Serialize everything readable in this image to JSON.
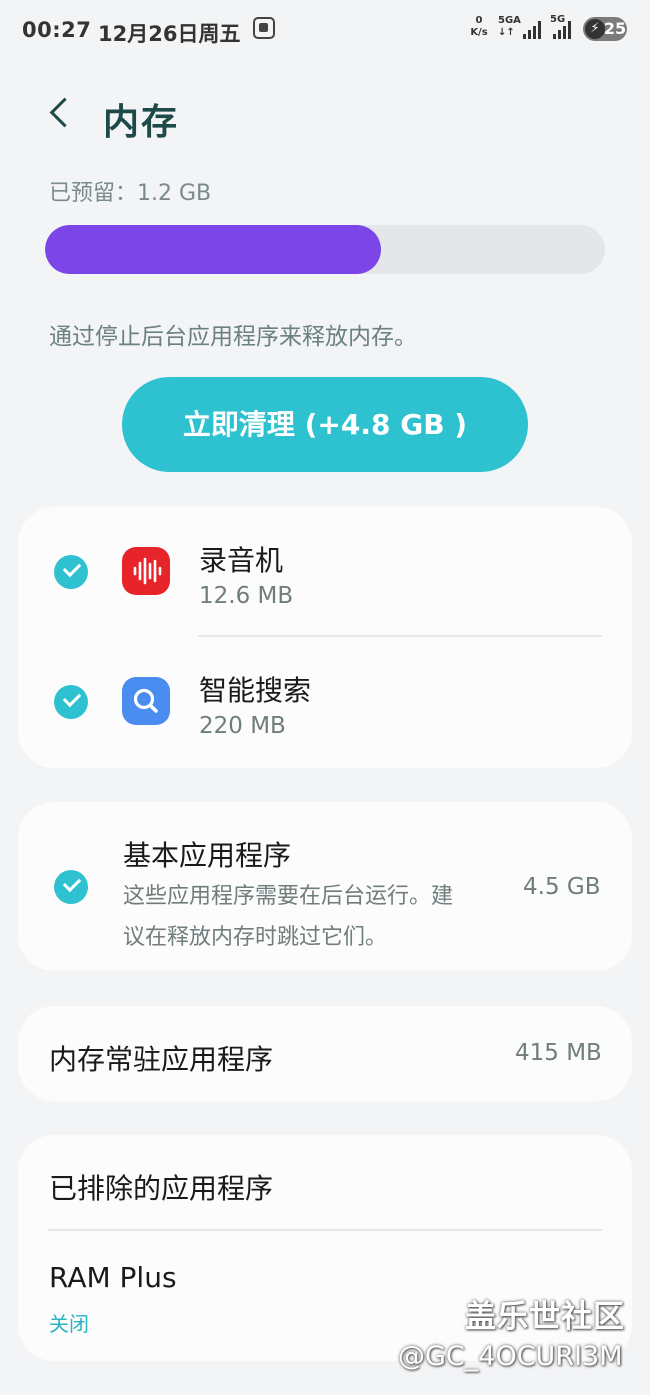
{
  "status_bar": {
    "time": "00:27",
    "date": "12月26日周五",
    "net_speed_value": "0",
    "net_speed_unit": "K/s",
    "sim1_label": "5GA",
    "sim2_label": "5G",
    "battery_level": "25"
  },
  "header": {
    "title": "内存"
  },
  "memory": {
    "reserved_label": "已预留：1.2 GB",
    "usage_fraction": 0.6,
    "bar_color": "#7b45e8",
    "hint": "通过停止后台应用程序来释放内存。",
    "clean_button_label": "立即清理 (+4.8 GB )"
  },
  "apps": [
    {
      "name": "录音机",
      "size": "12.6 MB",
      "icon": "voice-recorder-icon",
      "icon_color": "#e8242b"
    },
    {
      "name": "智能搜索",
      "size": "220 MB",
      "icon": "smart-search-icon",
      "icon_color": "#4a8cf0"
    }
  ],
  "basic_apps": {
    "title": "基本应用程序",
    "description_line1": "这些应用程序需要在后台运行。建",
    "description_line2": "议在释放内存时跳过它们。",
    "size": "4.5 GB"
  },
  "resident_apps": {
    "label": "内存常驻应用程序",
    "size": "415 MB"
  },
  "excluded_apps": {
    "label": "已排除的应用程序"
  },
  "ram_plus": {
    "label": "RAM Plus",
    "status": "关闭"
  },
  "watermark": {
    "site": "盖乐世社区",
    "user": "@GC_4OCURI3M"
  },
  "colors": {
    "accent": "#2ec1cf",
    "title": "#1e4a4a",
    "background": "#f3f4f6"
  }
}
